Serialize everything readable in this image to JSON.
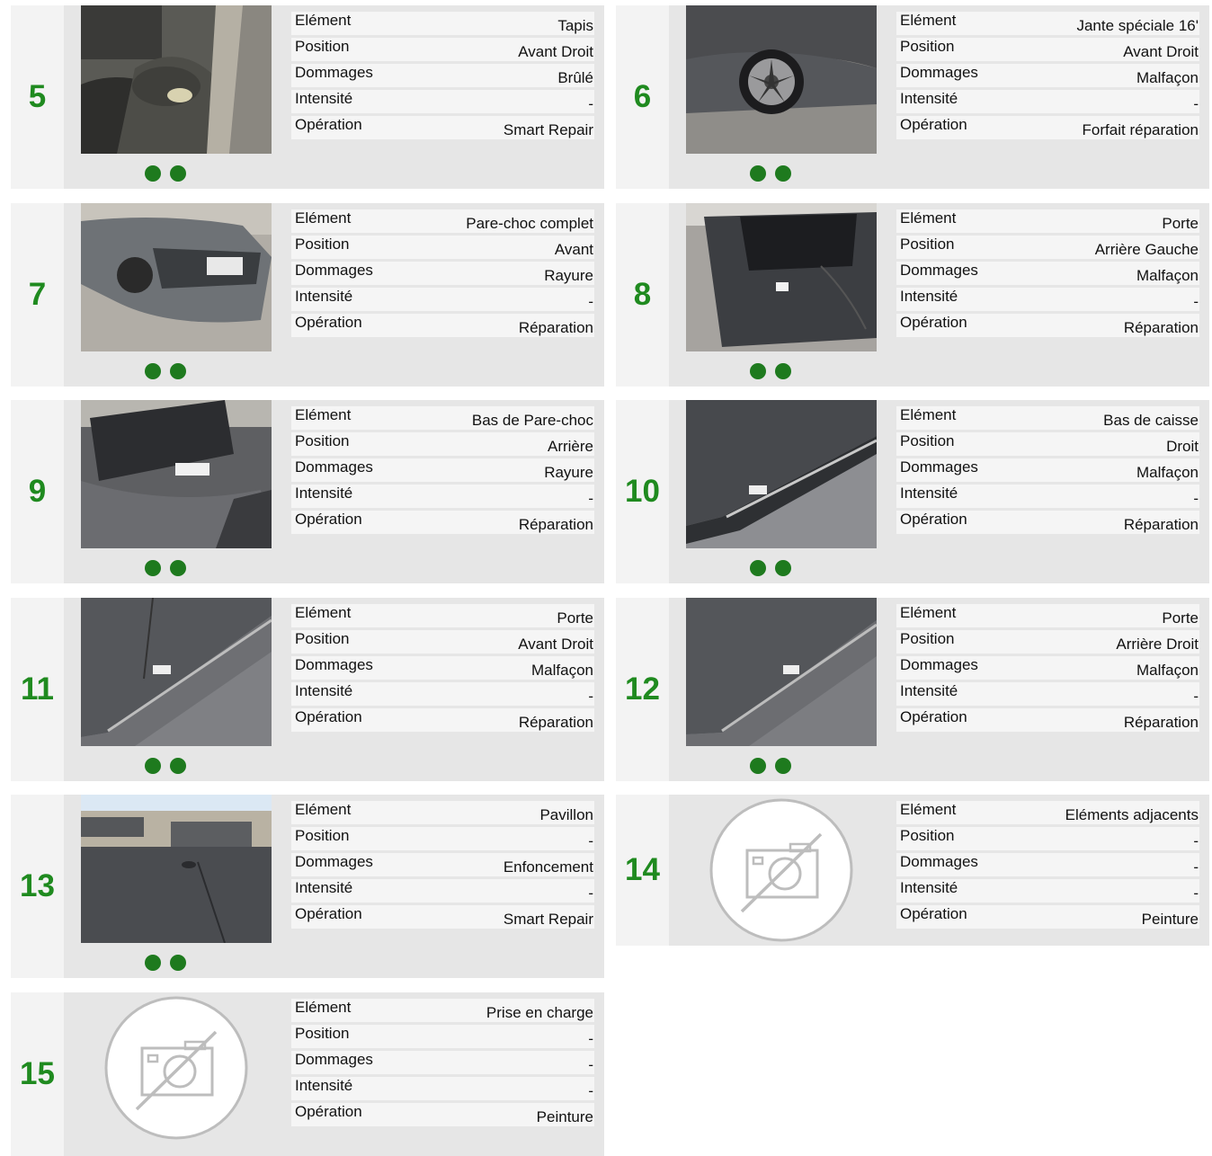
{
  "labels": {
    "element": "Elément",
    "position": "Position",
    "dommages": "Dommages",
    "intensite": "Intensité",
    "operation": "Opération"
  },
  "colors": {
    "number": "#1f8a1f",
    "dot": "#1e7a1e",
    "card_bg": "#e6e6e6"
  },
  "damages": [
    {
      "num": "5",
      "element": "Tapis",
      "position": "Avant Droit",
      "dommages": "Brûlé",
      "intensite": "-",
      "operation": "Smart Repair",
      "photo": "car-interior-floor-photo",
      "dots": 2
    },
    {
      "num": "6",
      "element": "Jante spéciale 16'",
      "position": "Avant Droit",
      "dommages": "Malfaçon",
      "intensite": "-",
      "operation": "Forfait réparation",
      "photo": "car-wheel-photo",
      "dots": 2
    },
    {
      "num": "7",
      "element": "Pare-choc complet",
      "position": "Avant",
      "dommages": "Rayure",
      "intensite": "-",
      "operation": "Réparation",
      "photo": "car-front-bumper-photo",
      "dots": 2
    },
    {
      "num": "8",
      "element": "Porte",
      "position": "Arrière Gauche",
      "dommages": "Malfaçon",
      "intensite": "-",
      "operation": "Réparation",
      "photo": "car-rear-door-photo",
      "dots": 2
    },
    {
      "num": "9",
      "element": "Bas de Pare-choc",
      "position": "Arrière",
      "dommages": "Rayure",
      "intensite": "-",
      "operation": "Réparation",
      "photo": "car-rear-bumper-photo",
      "dots": 2
    },
    {
      "num": "10",
      "element": "Bas de caisse",
      "position": "Droit",
      "dommages": "Malfaçon",
      "intensite": "-",
      "operation": "Réparation",
      "photo": "car-sill-photo",
      "dots": 2
    },
    {
      "num": "11",
      "element": "Porte",
      "position": "Avant Droit",
      "dommages": "Malfaçon",
      "intensite": "-",
      "operation": "Réparation",
      "photo": "car-front-door-photo",
      "dots": 2
    },
    {
      "num": "12",
      "element": "Porte",
      "position": "Arrière Droit",
      "dommages": "Malfaçon",
      "intensite": "-",
      "operation": "Réparation",
      "photo": "car-rear-right-door-photo",
      "dots": 2
    },
    {
      "num": "13",
      "element": "Pavillon",
      "position": "-",
      "dommages": "Enfoncement",
      "intensite": "-",
      "operation": "Smart Repair",
      "photo": "car-roof-photo",
      "dots": 2
    },
    {
      "num": "14",
      "element": "Eléments adjacents",
      "position": "-",
      "dommages": "-",
      "intensite": "-",
      "operation": "Peinture",
      "photo": "no-photo-icon",
      "dots": 0
    },
    {
      "num": "15",
      "element": "Prise en charge",
      "position": "-",
      "dommages": "-",
      "intensite": "-",
      "operation": "Peinture",
      "photo": "no-photo-icon",
      "dots": 0
    }
  ]
}
